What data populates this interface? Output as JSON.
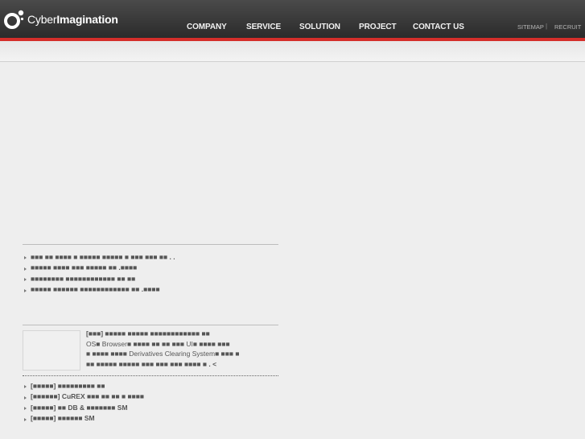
{
  "header": {
    "logo": {
      "prefix": "Cyber",
      "bold": "Imagination"
    },
    "nav": [
      {
        "label": "COMPANY"
      },
      {
        "label": "SERVICE"
      },
      {
        "label": "SOLUTION"
      },
      {
        "label": "PROJECT"
      },
      {
        "label": "CONTACT US"
      }
    ],
    "util": {
      "sitemap": "SITEMAP",
      "separator": "|",
      "recruit": "RECRUIT"
    }
  },
  "news": {
    "items": [
      {
        "text": "■■■ ■■ ■■■■ ■ ■■■■■ ■■■■■ ■ ■■■ ■■■ ■■ . ."
      },
      {
        "text": "■■■■■ ■■■■ ■■■ ■■■■■ ■■ .■■■■"
      },
      {
        "text": "■■■■■■■■ ■■■■■■■■■■■■ ■■ ■■"
      },
      {
        "text": "■■■■■ ■■■■■■ ■■■■■■■■■■■■ ■■ .■■■■"
      }
    ]
  },
  "feature": {
    "line1": "[■■■] ■■■■■ ■■■■■ ■■■■■■■■■■■■ ■■",
    "line2_a": "OS■ ",
    "line2_b": "Browser",
    "line2_c": "■ ■■■■ ■■ ■■ ■■■ ",
    "line2_d": "UI",
    "line2_e": "■ ■■■■ ■■■",
    "line3_a": "■ ■■■■ ■■■■ ",
    "line3_b": "Derivatives Clearing System",
    "line3_c": "■ ■■■ ■",
    "line4": "■■ ■■■■■ ■■■■■ ■■■ ■■■ ■■■ ■■■■ ■ . <"
  },
  "projects": {
    "items": [
      {
        "prefix": "[■■■■■] ",
        "text": "■■■■■■■■■ ■■"
      },
      {
        "prefix": "[■■■■■■] ",
        "text": "CuREX ■■■ ■■ ■■ ■ ■■■■"
      },
      {
        "prefix": "[■■■■■] ",
        "text": "■■ DB & ■■■■■■■ SM"
      },
      {
        "prefix": "[■■■■■] ",
        "text": "■■■■■■ SM"
      }
    ]
  }
}
